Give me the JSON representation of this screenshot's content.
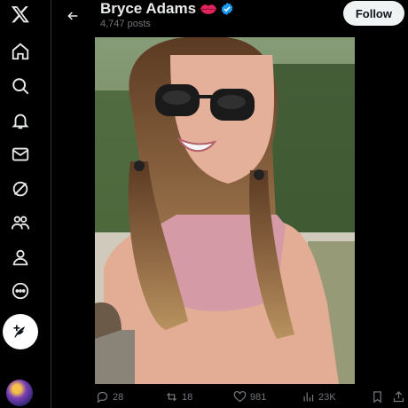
{
  "header": {
    "name": "Bryce Adams",
    "post_count": "4,747 posts",
    "follow_label": "Follow"
  },
  "actions": {
    "replies": "28",
    "reposts": "18",
    "likes": "981",
    "views": "23K"
  },
  "colors": {
    "accent": "#1d9bf0",
    "background": "#000000",
    "muted_text": "#71767b"
  },
  "icons": [
    "x-logo-icon",
    "home-icon",
    "search-icon",
    "notifications-icon",
    "messages-icon",
    "grok-icon",
    "communities-icon",
    "profile-icon",
    "more-icon",
    "compose-icon",
    "back-arrow-icon",
    "lips-icon",
    "verified-icon",
    "reply-icon",
    "repost-icon",
    "like-icon",
    "views-icon",
    "bookmark-icon",
    "share-icon"
  ]
}
